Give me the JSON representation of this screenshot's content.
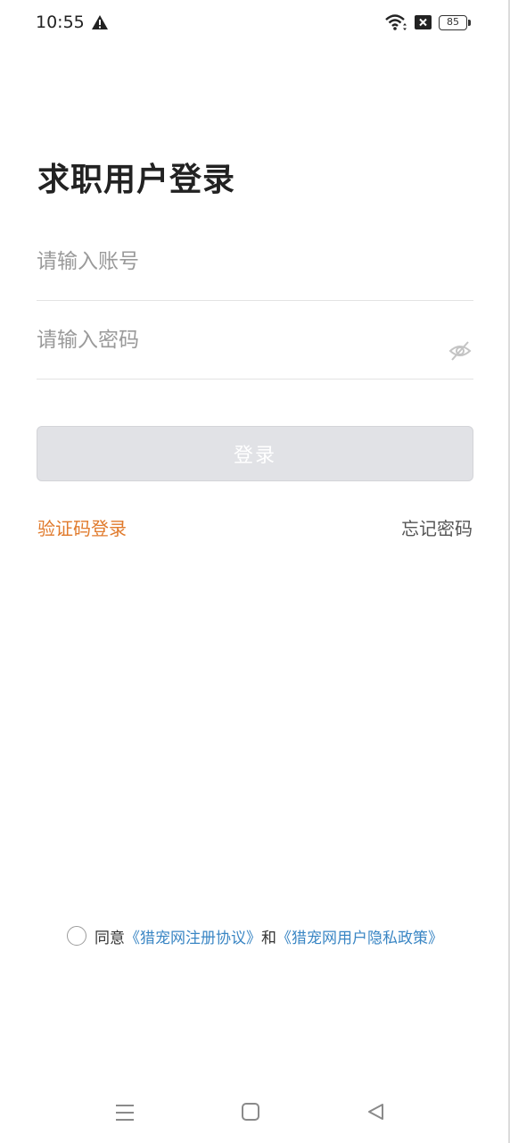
{
  "status_bar": {
    "time": "10:55",
    "battery_level": "85"
  },
  "login": {
    "title": "求职用户登录",
    "account_placeholder": "请输入账号",
    "password_placeholder": "请输入密码",
    "login_button": "登录",
    "sms_login": "验证码登录",
    "forgot_password": "忘记密码"
  },
  "agreement": {
    "agree_text": "同意",
    "register_agreement": "《猎宠网注册协议》",
    "and_text": "和",
    "privacy_policy": "《猎宠网用户隐私政策》",
    "checked": false
  },
  "icons": {
    "warning": "warning-icon",
    "wifi": "wifi-icon",
    "sim": "sim-icon",
    "battery": "battery-icon",
    "password_visibility": "eye-off-icon",
    "nav_menu": "menu-icon",
    "nav_home": "home-icon",
    "nav_back": "back-icon"
  },
  "colors": {
    "accent": "#e07a2c",
    "link": "#3a86c4",
    "button_disabled": "#e1e2e6",
    "title": "#222222"
  }
}
